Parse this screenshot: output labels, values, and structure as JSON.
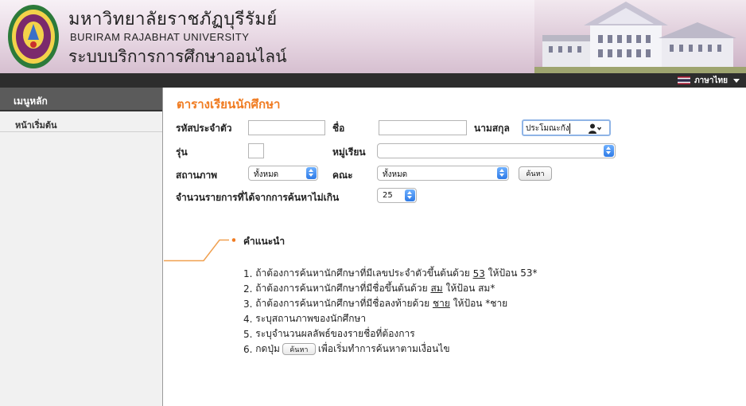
{
  "header": {
    "thai_name": "มหาวิทยาลัยราชภัฏบุรีรัมย์",
    "english_name": "BURIRAM RAJABHAT UNIVERSITY",
    "system_name": "ระบบบริการการศึกษาออนไลน์"
  },
  "topbar": {
    "language_label": "ภาษาไทย"
  },
  "sidebar": {
    "title": "เมนูหลัก",
    "items": [
      {
        "label": "หน้าเริ่มต้น"
      }
    ]
  },
  "main": {
    "title": "ตารางเรียนนักศึกษา",
    "form": {
      "student_id_label": "รหัสประจำตัว",
      "student_id_value": "",
      "first_name_label": "ชื่อ",
      "first_name_value": "",
      "surname_label": "นามสกุล",
      "surname_value": "ประโมณะกัง",
      "cohort_label": "รุ่น",
      "cohort_value": "",
      "group_label": "หมู่เรียน",
      "group_value": "",
      "status_label": "สถานภาพ",
      "status_value": "ทั้งหมด",
      "faculty_label": "คณะ",
      "faculty_value": "ทั้งหมด",
      "search_button": "ค้นหา",
      "limit_label": "จำนวนรายการที่ได้จากการค้นหาไม่เกิน",
      "limit_value": "25"
    },
    "guide": {
      "title": "คำแนะนำ",
      "items": [
        {
          "no": "1.",
          "pre": "ถ้าต้องการค้นหานักศึกษาที่มีเลขประจำตัวขึ้นต้นด้วย",
          "key": "53",
          "post": "ให้ป้อน 53*"
        },
        {
          "no": "2.",
          "pre": "ถ้าต้องการค้นหานักศึกษาที่มีชื่อขึ้นต้นด้วย",
          "key": "สม",
          "post": "ให้ป้อน สม*"
        },
        {
          "no": "3.",
          "pre": "ถ้าต้องการค้นหานักศึกษาที่มีชื่อลงท้ายด้วย",
          "key": "ชาย",
          "post": "ให้ป้อน *ชาย"
        },
        {
          "no": "4.",
          "text": "ระบุสถานภาพของนักศึกษา"
        },
        {
          "no": "5.",
          "text": "ระบุจำนวนผลลัพธ์ของรายชื่อที่ต้องการ"
        },
        {
          "no": "6.",
          "pre": "กดปุ่ม",
          "button": "ค้นหา",
          "post": "เพื่อเริ่มทำการค้นหาตามเงื่อนไข"
        }
      ]
    }
  },
  "colors": {
    "accent": "#f07c22",
    "topbar": "#2d2d2d",
    "sidebar_header": "#5b5b5b"
  }
}
